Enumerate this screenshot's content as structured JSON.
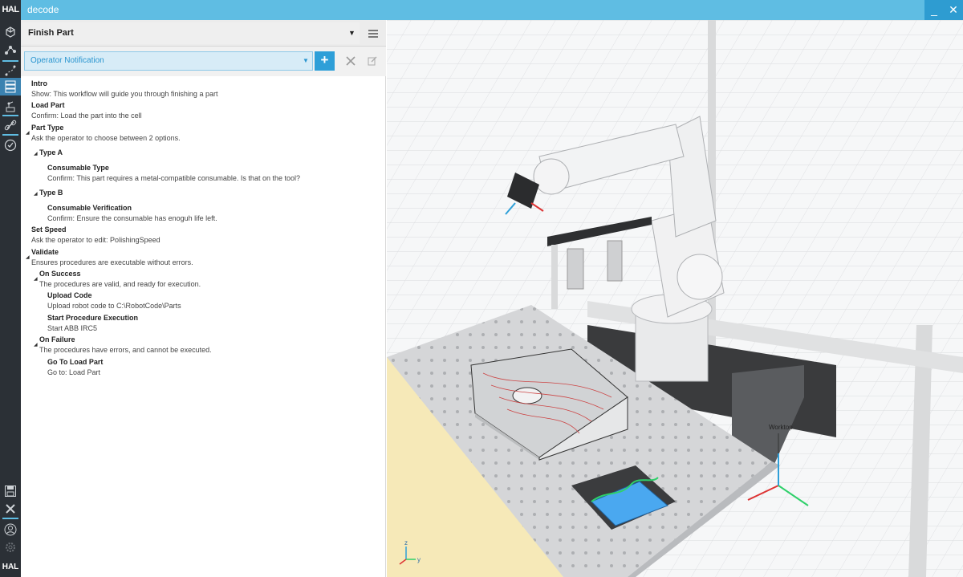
{
  "app": {
    "logo": "HAL",
    "title": "decode",
    "minimize": "_",
    "close": "✕"
  },
  "toolrail": {
    "items": [
      "cube-icon",
      "graph-icon",
      "path-icon",
      "workflow-icon",
      "robot-icon",
      "link-icon",
      "check-circle-icon"
    ],
    "bottom_items": [
      "save-icon",
      "close-icon",
      "user-icon",
      "settings-icon"
    ],
    "bottom_logo": "HAL"
  },
  "workflow": {
    "title": "Finish Part",
    "step_type": "Operator Notification",
    "add_label": "+"
  },
  "tree": [
    {
      "title": "Intro",
      "desc": "Show: This workflow will guide you through finishing a part"
    },
    {
      "title": "Load Part",
      "desc": "Confirm: Load the part into the cell"
    },
    {
      "title": "Part Type",
      "desc": "Ask the operator to choose between 2 options."
    },
    {
      "title": "Type A",
      "desc": ""
    },
    {
      "title": "Consumable Type",
      "desc": "Confirm: This part requires a metal-compatible consumable. Is that on the tool?"
    },
    {
      "title": "Type B",
      "desc": ""
    },
    {
      "title": "Consumable Verification",
      "desc": "Confirm: Ensure the consumable has enoguh life left."
    },
    {
      "title": "Set Speed",
      "desc": "Ask the operator to edit: PolishingSpeed"
    },
    {
      "title": "Validate",
      "desc": "Ensures procedures are executable without errors."
    },
    {
      "title": "On Success",
      "desc": "The procedures are valid, and ready for execution."
    },
    {
      "title": "Upload Code",
      "desc": "Upload robot code to C:\\RobotCode\\Parts"
    },
    {
      "title": "Start Procedure Execution",
      "desc": "Start ABB IRC5"
    },
    {
      "title": "On Failure",
      "desc": "The procedures have errors, and cannot be executed."
    },
    {
      "title": "Go To Load Part",
      "desc": "Go to: Load Part"
    }
  ],
  "viewport": {
    "worktop_label": "Worktop",
    "axis_z": "z",
    "axis_y": "y",
    "colors": {
      "accent": "#2e9fd8",
      "part": "#4aa8f0",
      "grid": "#d7d9dc"
    }
  }
}
